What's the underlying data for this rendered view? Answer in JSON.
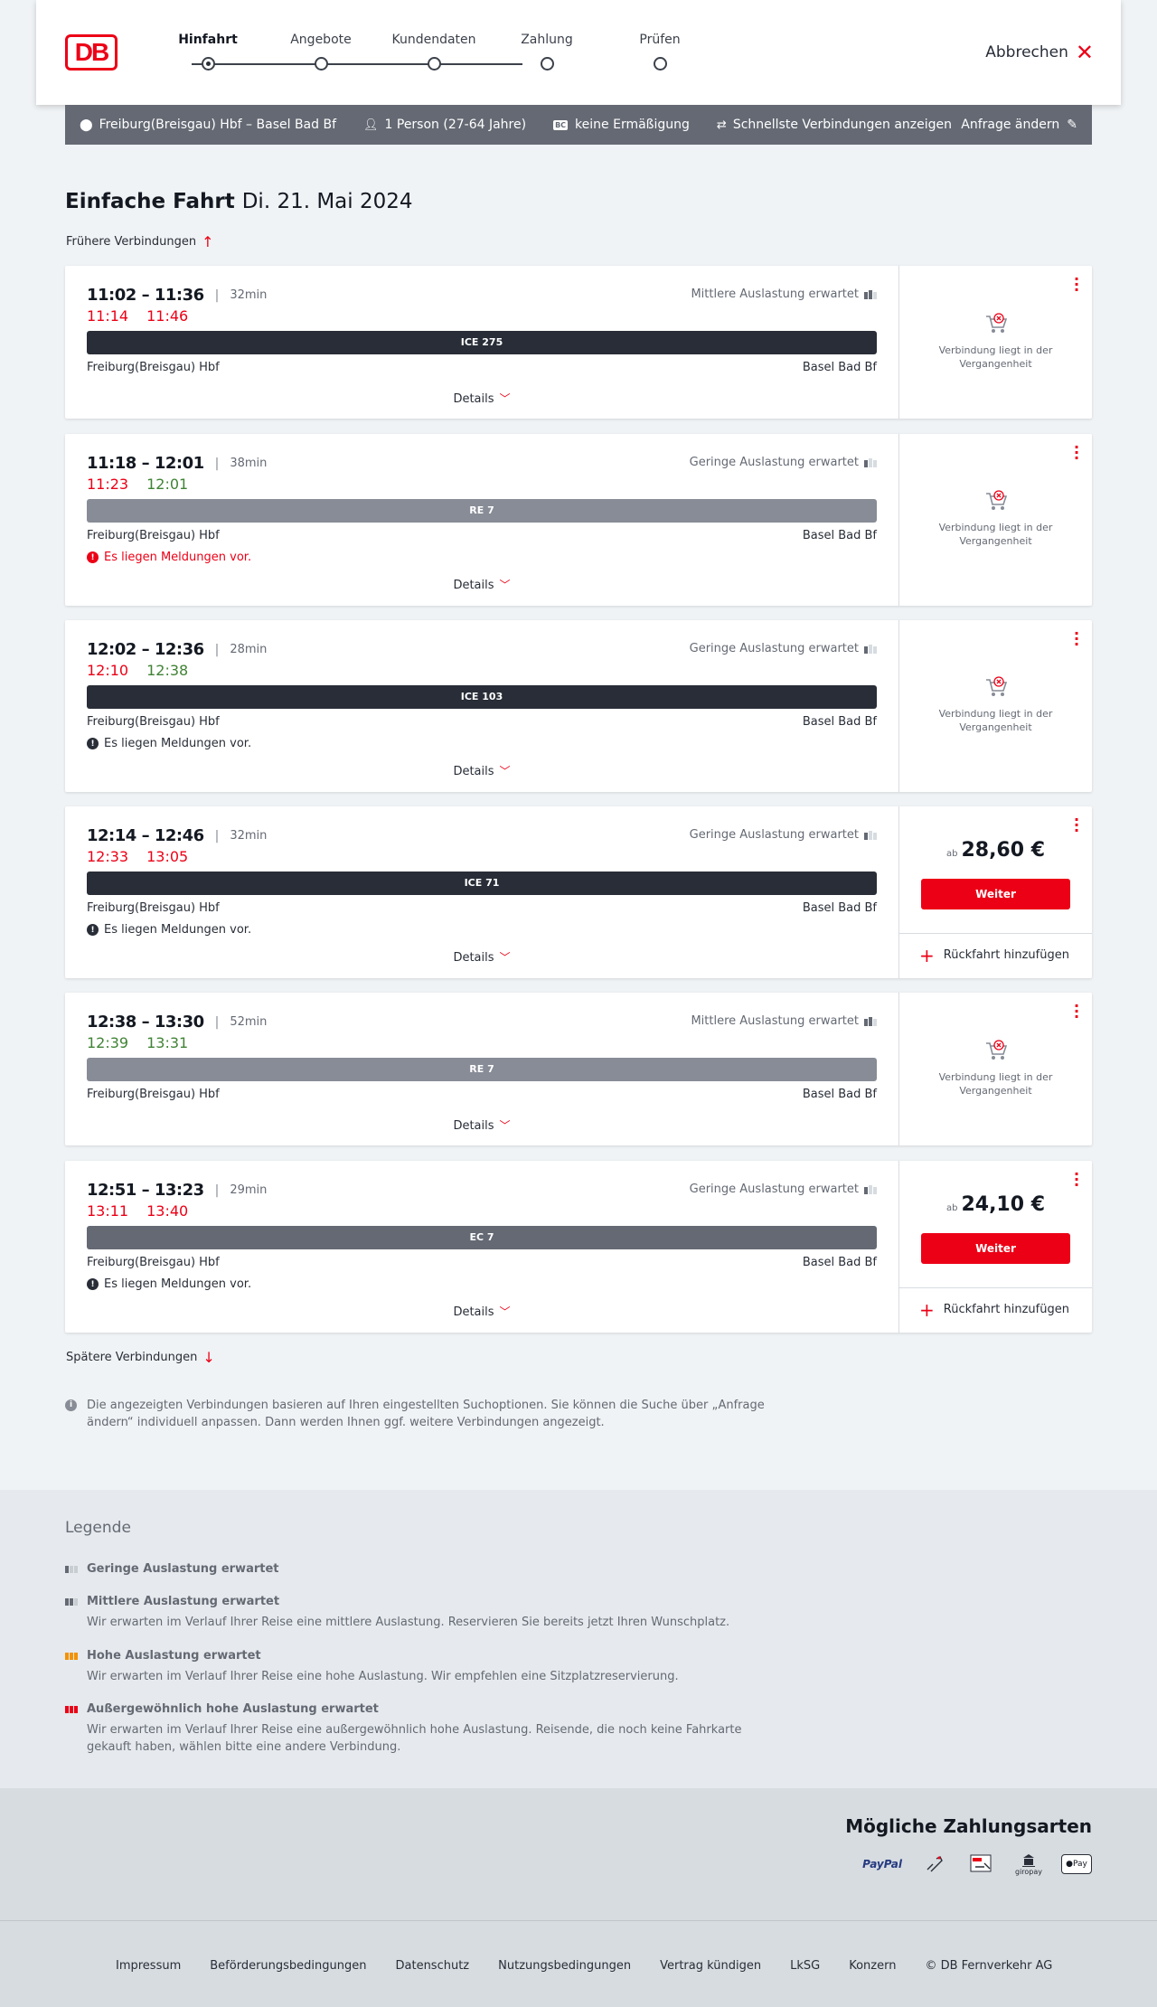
{
  "header": {
    "logo": "DB",
    "steps": [
      {
        "label": "Hinfahrt",
        "active": true
      },
      {
        "label": "Angebote",
        "active": false
      },
      {
        "label": "Kundendaten",
        "active": false
      },
      {
        "label": "Zahlung",
        "active": false
      },
      {
        "label": "Prüfen",
        "active": false
      }
    ],
    "cancel_label": "Abbrechen"
  },
  "summary": {
    "route": "Freiburg(Breisgau) Hbf – Basel Bad Bf",
    "passengers": "1 Person (27-64 Jahre)",
    "bahncard_icon": "BC",
    "discount": "keine Ermäßigung",
    "fastest": "Schnellste Verbindungen anzeigen",
    "change": "Anfrage ändern"
  },
  "title": {
    "main": "Einfache Fahrt",
    "date": "Di. 21. Mai 2024"
  },
  "earlier": "Frühere Verbindungen",
  "later": "Spätere Verbindungen",
  "common": {
    "details": "Details",
    "past": "Verbindung liegt in der Vergangenheit",
    "ab": "ab",
    "weiter": "Weiter",
    "return": "Rückfahrt hinzufügen",
    "from": "Freiburg(Breisgau) Hbf",
    "to": "Basel Bad Bf"
  },
  "connections": [
    {
      "time": "11:02 – 11:36",
      "duration": "32min",
      "rt_dep": "11:14",
      "rt_arr": "11:46",
      "load": "Mittlere Auslastung erwartet",
      "train": "ICE 275",
      "message": ""
    },
    {
      "time": "11:18 – 12:01",
      "duration": "38min",
      "rt_dep": "11:23",
      "rt_arr": "12:01",
      "load": "Geringe Auslastung erwartet",
      "train": "RE 7",
      "message": "Es liegen Meldungen vor."
    },
    {
      "time": "12:02 – 12:36",
      "duration": "28min",
      "rt_dep": "12:10",
      "rt_arr": "12:38",
      "load": "Geringe Auslastung erwartet",
      "train": "ICE 103",
      "message": "Es liegen Meldungen vor."
    },
    {
      "time": "12:14 – 12:46",
      "duration": "32min",
      "rt_dep": "12:33",
      "rt_arr": "13:05",
      "load": "Geringe Auslastung erwartet",
      "train": "ICE 71",
      "message": "Es liegen Meldungen vor.",
      "price": "28,60 €"
    },
    {
      "time": "12:38 – 13:30",
      "duration": "52min",
      "rt_dep": "12:39",
      "rt_arr": "13:31",
      "load": "Mittlere Auslastung erwartet",
      "train": "RE 7",
      "message": ""
    },
    {
      "time": "12:51 – 13:23",
      "duration": "29min",
      "rt_dep": "13:11",
      "rt_arr": "13:40",
      "load": "Geringe Auslastung erwartet",
      "train": "EC 7",
      "message": "Es liegen Meldungen vor.",
      "price": "24,10 €"
    }
  ],
  "info_text": "Die angezeigten Verbindungen basieren auf Ihren eingestellten Suchoptionen. Sie können die Suche über „Anfrage ändern“ individuell anpassen. Dann werden Ihnen ggf. weitere Verbindungen angezeigt.",
  "legend": {
    "title": "Legende",
    "entries": [
      {
        "title": "Geringe Auslastung erwartet",
        "desc": ""
      },
      {
        "title": "Mittlere Auslastung erwartet",
        "desc": "Wir erwarten im Verlauf Ihrer Reise eine mittlere Auslastung. Reservieren Sie bereits jetzt Ihren Wunschplatz."
      },
      {
        "title": "Hohe Auslastung erwartet",
        "desc": "Wir erwarten im Verlauf Ihrer Reise eine hohe Auslastung. Wir empfehlen eine Sitzplatzreservierung."
      },
      {
        "title": "Außergewöhnlich hohe Auslastung erwartet",
        "desc": "Wir erwarten im Verlauf Ihrer Reise eine außergewöhnlich hohe Auslastung. Reisende, die noch keine Fahrkarte gekauft haben, wählen bitte eine andere Verbindung."
      }
    ]
  },
  "payment": {
    "title": "Mögliche Zahlungsarten",
    "paypal": "PayPal",
    "sepa": "SEPA",
    "giropay": "giropay",
    "applepay": "Pay"
  },
  "footer": {
    "links": [
      "Impressum",
      "Beförderungsbedingungen",
      "Datenschutz",
      "Nutzungsbedingungen",
      "Vertrag kündigen",
      "LkSG",
      "Konzern",
      "© DB Fernverkehr AG"
    ]
  },
  "colors": {
    "brand": "#ec0016",
    "late": "#ec0016",
    "ontime": "#408335",
    "dark": "#282d37"
  }
}
